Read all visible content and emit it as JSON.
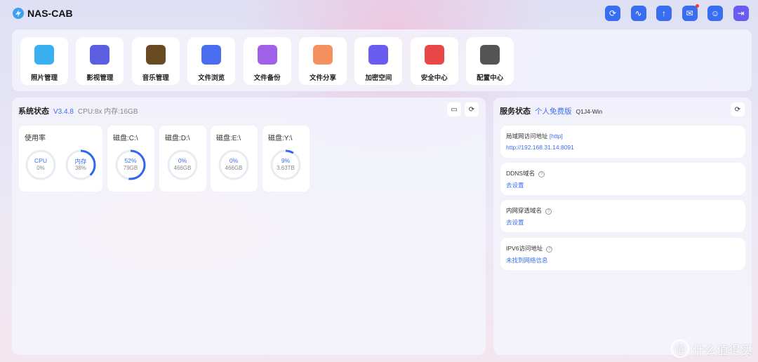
{
  "app": {
    "name": "NAS-CAB"
  },
  "toolbar": [
    {
      "icon": "refresh-icon",
      "glyph": "⟳"
    },
    {
      "icon": "activity-icon",
      "glyph": "∿"
    },
    {
      "icon": "upload-icon",
      "glyph": "↑"
    },
    {
      "icon": "mail-icon",
      "glyph": "✉",
      "badge": true
    },
    {
      "icon": "user-icon",
      "glyph": "☺"
    },
    {
      "icon": "logout-icon",
      "glyph": "⇥"
    }
  ],
  "apps": [
    {
      "label": "照片管理",
      "color": "#3ab0f0"
    },
    {
      "label": "影视管理",
      "color": "#5b5ee0"
    },
    {
      "label": "音乐管理",
      "color": "#6a4a20"
    },
    {
      "label": "文件浏览",
      "color": "#4a6ef0"
    },
    {
      "label": "文件备份",
      "color": "#a060e8"
    },
    {
      "label": "文件分享",
      "color": "#f59060"
    },
    {
      "label": "加密空间",
      "color": "#6a5cf0"
    },
    {
      "label": "安全中心",
      "color": "#e84848"
    },
    {
      "label": "配置中心",
      "color": "#555555"
    }
  ],
  "system": {
    "title": "系统状态",
    "version": "V3.4.8",
    "spec": "CPU:8x 内存:16GB",
    "usage": {
      "title": "使用率",
      "cpu": {
        "label": "CPU",
        "value": "0%",
        "percent": 0
      },
      "mem": {
        "label": "内存",
        "value": "38%",
        "percent": 38
      }
    },
    "disks": [
      {
        "title": "磁盘:C:\\",
        "percent_label": "52%",
        "size": "79GB",
        "percent": 52
      },
      {
        "title": "磁盘:D:\\",
        "percent_label": "0%",
        "size": "466GB",
        "percent": 0
      },
      {
        "title": "磁盘:E:\\",
        "percent_label": "0%",
        "size": "466GB",
        "percent": 0
      },
      {
        "title": "磁盘:Y:\\",
        "percent_label": "9%",
        "size": "3.63TB",
        "percent": 9
      }
    ]
  },
  "service": {
    "title": "服务状态",
    "edition": "个人免费版",
    "host": "Q1J4-Win",
    "items": [
      {
        "label": "局域网访问地址",
        "tag": "[http]",
        "value": "http://192.168.31.14:8091"
      },
      {
        "label": "DDNS域名",
        "help": "?",
        "value": "去设置"
      },
      {
        "label": "内网穿透域名",
        "help": "?",
        "value": "去设置"
      },
      {
        "label": "IPV6访问地址",
        "help": "?",
        "value": "未找到网络信息"
      }
    ]
  },
  "watermark": {
    "glyph": "值",
    "text": "什么值得买"
  }
}
